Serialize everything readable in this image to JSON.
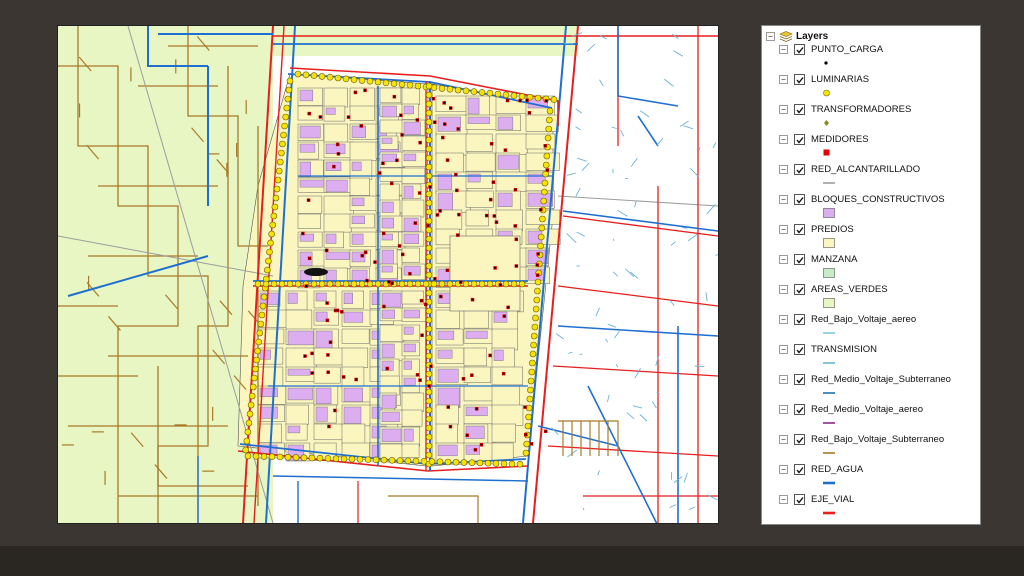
{
  "toc": {
    "root_label": "Layers",
    "layers": [
      {
        "name": "PUNTO_CARGA",
        "checked": true,
        "symbol": "point-black",
        "color": "#000000"
      },
      {
        "name": "LUMINARIAS",
        "checked": true,
        "symbol": "circle-yellow",
        "color": "#f5e400"
      },
      {
        "name": "TRANSFORMADORES",
        "checked": true,
        "symbol": "diamond-olive",
        "color": "#8a8a20"
      },
      {
        "name": "MEDIDORES",
        "checked": true,
        "symbol": "square-red",
        "color": "#e60000"
      },
      {
        "name": "RED_ALCANTARILLADO",
        "checked": true,
        "symbol": "line-gray",
        "color": "#9c9c9c"
      },
      {
        "name": "BLOQUES_CONSTRUCTIVOS",
        "checked": true,
        "symbol": "fill-purple",
        "color": "#dcaef0"
      },
      {
        "name": "PREDIOS",
        "checked": true,
        "symbol": "fill-cream",
        "color": "#fbf6c0"
      },
      {
        "name": "MANZANA",
        "checked": true,
        "symbol": "fill-lightgreen",
        "color": "#c8ecc8"
      },
      {
        "name": "AREAS_VERDES",
        "checked": true,
        "symbol": "fill-palegreen",
        "color": "#e8f6c4"
      },
      {
        "name": "Red_Bajo_Voltaje_aereo",
        "checked": true,
        "symbol": "line-lightblue",
        "color": "#7ec8e0"
      },
      {
        "name": "TRANSMISION",
        "checked": true,
        "symbol": "line-steelblue",
        "color": "#6ab4d4"
      },
      {
        "name": "Red_Medio_Voltaje_Subterraneo",
        "checked": true,
        "symbol": "line-darkblue",
        "color": "#1e6fb4"
      },
      {
        "name": "Red_Medio_Voltaje_aereo",
        "checked": true,
        "symbol": "line-purple",
        "color": "#8a2a8a"
      },
      {
        "name": "Red_Bajo_Voltaje_Subterraneo",
        "checked": true,
        "symbol": "line-brown",
        "color": "#a87a28"
      },
      {
        "name": "RED_AGUA",
        "checked": true,
        "symbol": "line-blue",
        "color": "#1f6fd0"
      },
      {
        "name": "EJE_VIAL",
        "checked": true,
        "symbol": "line-red",
        "color": "#e81e1e"
      }
    ]
  },
  "map": {
    "colors": {
      "areas_verdes": "#e8f6c4",
      "predios": "#fbf6c0",
      "bloques": "#dcaef0",
      "eje_vial": "#e81e1e",
      "red_agua": "#1f6fd0",
      "bajo_subterraneo": "#a87a28",
      "luminarias": "#f5e400",
      "medidores": "#e60000",
      "punto_carga": "#000000",
      "transmision": "#6ab4d4"
    }
  }
}
